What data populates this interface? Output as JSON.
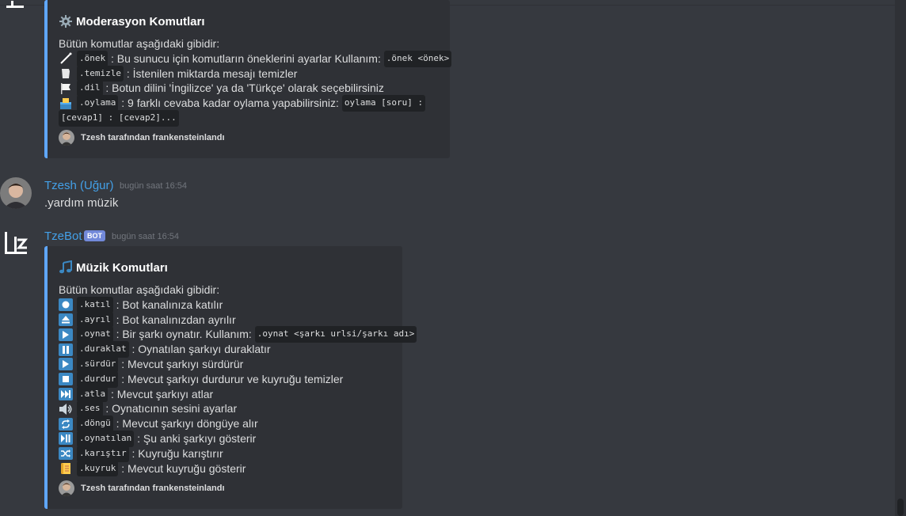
{
  "moderation_embed": {
    "title": "Moderasyon Komutları",
    "intro": "Bütün komutlar aşağıdaki gibidir:",
    "commands": [
      {
        "icon": "wand-icon",
        "cmd": ".önek",
        "sep": " : ",
        "text": "Bu sunucu için komutların öneklerini ayarlar Kullanım: ",
        "usage": ".önek <önek>"
      },
      {
        "icon": "paper-icon",
        "cmd": ".temizle",
        "sep": " : ",
        "text": "İstenilen miktarda mesajı temizler",
        "usage": ""
      },
      {
        "icon": "flag-icon",
        "cmd": ".dil",
        "sep": " : ",
        "text": "Botun dilini 'İngilizce' ya da 'Türkçe' olarak seçebilirsiniz",
        "usage": ""
      },
      {
        "icon": "ballot-box-icon",
        "cmd": ".oylama",
        "sep": " : ",
        "text": "9 farklı cevaba kadar oylama yapabilirsiniz: ",
        "usage": "oylama [soru] :"
      }
    ],
    "usage_continued": "[cevap1] : [cevap2]...",
    "footer": "Tzesh tarafından frankensteinlandı"
  },
  "user_message": {
    "username": "Tzesh (Uğur)",
    "timestamp": "bugün saat 16:54",
    "content": ".yardım müzik"
  },
  "bot_message": {
    "username": "TzeBot",
    "badge": "BOT",
    "timestamp": "bugün saat 16:54"
  },
  "music_embed": {
    "title": "Müzik Komutları",
    "intro": "Bütün komutlar aşağıdaki gibidir:",
    "commands": [
      {
        "icon": "record-icon",
        "cmd": ".katıl",
        "sep": " : ",
        "text": "Bot kanalınıza katılır",
        "usage": ""
      },
      {
        "icon": "eject-icon",
        "cmd": ".ayrıl",
        "sep": " : ",
        "text": "Bot kanalınızdan ayrılır",
        "usage": ""
      },
      {
        "icon": "play-icon",
        "cmd": ".oynat",
        "sep": " : ",
        "text": "Bir şarkı oynatır. Kullanım: ",
        "usage": ".oynat <şarkı urlsi/şarkı adı>"
      },
      {
        "icon": "pause-icon",
        "cmd": ".duraklat",
        "sep": " : ",
        "text": "Oynatılan şarkıyı duraklatır",
        "usage": ""
      },
      {
        "icon": "play-icon",
        "cmd": ".sürdür",
        "sep": " : ",
        "text": "Mevcut şarkıyı sürdürür",
        "usage": ""
      },
      {
        "icon": "stop-icon",
        "cmd": ".durdur",
        "sep": " : ",
        "text": "Mevcut şarkıyı durdurur ve kuyruğu temizler",
        "usage": ""
      },
      {
        "icon": "skip-icon",
        "cmd": ".atla",
        "sep": " : ",
        "text": "Mevcut şarkıyı atlar",
        "usage": ""
      },
      {
        "icon": "speaker-icon",
        "cmd": ".ses",
        "sep": " : ",
        "text": "Oynatıcının sesini ayarlar",
        "usage": ""
      },
      {
        "icon": "repeat-icon",
        "cmd": ".döngü",
        "sep": " : ",
        "text": "Mevcut şarkıyı döngüye alır",
        "usage": ""
      },
      {
        "icon": "play-pause-icon",
        "cmd": ".oynatılan",
        "sep": " : ",
        "text": "Şu anki şarkıyı gösterir",
        "usage": ""
      },
      {
        "icon": "shuffle-icon",
        "cmd": ".karıştır",
        "sep": " : ",
        "text": "Kuyruğu karıştırır",
        "usage": ""
      },
      {
        "icon": "scroll-icon",
        "cmd": ".kuyruk",
        "sep": " : ",
        "text": "Mevcut kuyruğu gösterir",
        "usage": ""
      }
    ],
    "footer": "Tzesh tarafından frankensteinlandı"
  }
}
